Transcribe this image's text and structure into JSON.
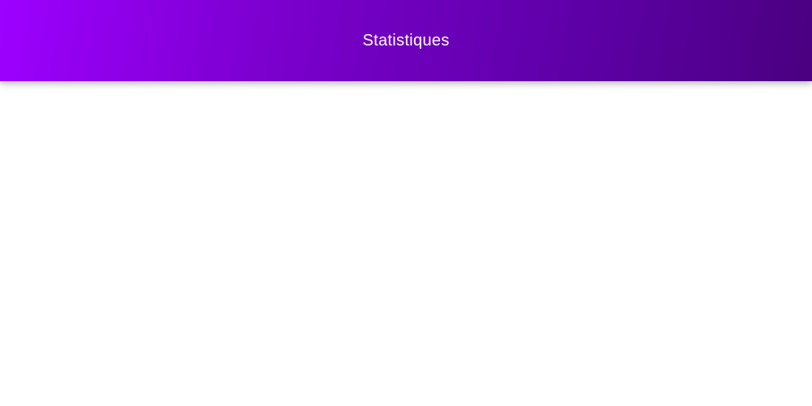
{
  "header": {
    "title": "Statistiques",
    "gradient_start": "#9d00ff",
    "gradient_end": "#4a0080"
  },
  "main": {
    "background": "#ffffff"
  }
}
